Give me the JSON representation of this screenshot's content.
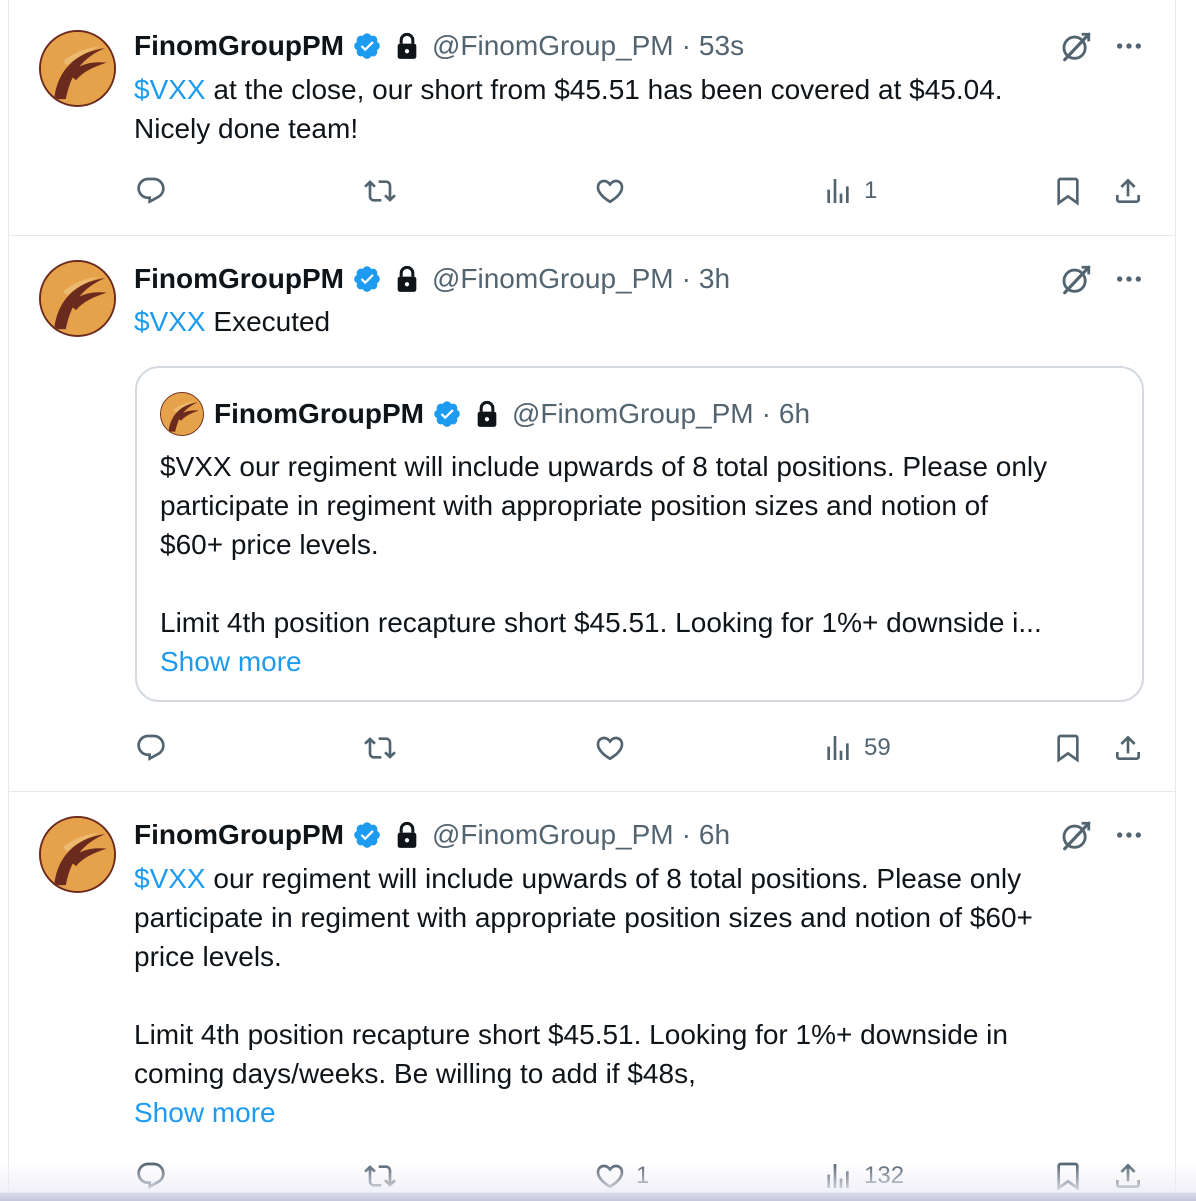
{
  "tweets": [
    {
      "name": "FinomGroupPM",
      "handle": "@FinomGroup_PM",
      "sep": "·",
      "time": "53s",
      "cashtag": "$VXX",
      "text_line1_rest": " at the close, our short from $45.51 has been covered at $45.04.",
      "text_line2": "Nicely done team!",
      "views": "1",
      "likes": ""
    },
    {
      "name": "FinomGroupPM",
      "handle": "@FinomGroup_PM",
      "sep": "·",
      "time": "3h",
      "cashtag": "$VXX",
      "text_rest": " Executed",
      "views": "59",
      "likes": "",
      "quote": {
        "name": "FinomGroupPM",
        "handle": "@FinomGroup_PM",
        "sep": "·",
        "time": "6h",
        "line1": "$VXX our regiment will include upwards of 8 total positions. Please only",
        "line2": "participate in regiment with appropriate position sizes and notion of",
        "line3": "$60+ price levels.",
        "line4": "Limit 4th position recapture short $45.51. Looking for 1%+ downside i...",
        "show_more": "Show more"
      }
    },
    {
      "name": "FinomGroupPM",
      "handle": "@FinomGroup_PM",
      "sep": "·",
      "time": "6h",
      "cashtag": "$VXX",
      "line1_rest": " our regiment will include upwards of 8 total positions. Please only",
      "line2": "participate in regiment with appropriate position sizes and notion of $60+",
      "line3": "price levels.",
      "line4": "Limit 4th position recapture short $45.51. Looking for 1%+ downside in",
      "line5": "coming days/weeks. Be willing to add if $48s,",
      "show_more": "Show more",
      "likes": "1",
      "views": "132"
    }
  ],
  "icons": {
    "reply": "reply-icon",
    "retweet": "retweet-icon",
    "like": "heart-icon",
    "views": "views-icon",
    "bookmark": "bookmark-icon",
    "share": "share-icon",
    "grok": "grok-icon",
    "more": "more-icon",
    "verified": "verified-badge-icon",
    "lock": "lock-icon"
  },
  "colors": {
    "link": "#1d9bf0",
    "muted": "#536471",
    "text": "#0f1419",
    "verified": "#1d9bf0",
    "avatar_bg": "#e6a24a",
    "avatar_ring": "#6b2a1e"
  }
}
